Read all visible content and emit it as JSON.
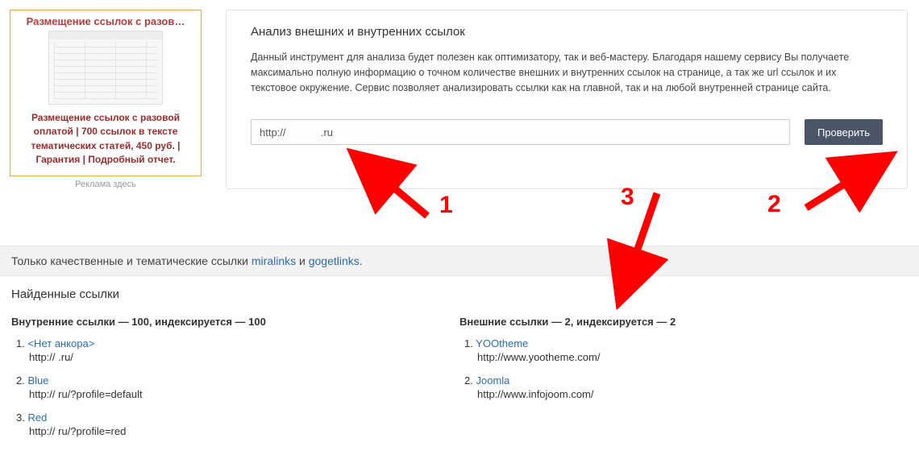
{
  "ad": {
    "title": "Размещение ссылок с разов…",
    "description": "Размещение ссылок с разовой оплатой | 700 ссылок в тексте тематических статей, 450 руб. | Гарантия | Подробный отчет.",
    "below": "Реклама здесь"
  },
  "panel": {
    "heading": "Анализ внешних и внутренних ссылок",
    "text": "Данный инструмент для анализа будет полезен как оптимизатору, так и веб-мастеру. Благодаря нашему сервису Вы получаете максимально полную информацию о точном количестве внешних и внутренних ссылок на странице, а так же url ссылок и их текстовое окружение. Сервис позволяет анализировать ссылки как на главной, так и на любой внутренней странице сайта.",
    "url_value": "http://            .ru",
    "button": "Проверить"
  },
  "banner": {
    "prefix": "Только качественные и тематические ссылки ",
    "link1": "miralinks",
    "joiner": " и ",
    "link2": "gogetlinks",
    "suffix": "."
  },
  "results": {
    "heading": "Найденные ссылки",
    "internal_heading": "Внутренние ссылки — 100, индексируется — 100",
    "external_heading": "Внешние ссылки — 2, индексируется — 2",
    "internal": [
      {
        "n": "1.",
        "anchor": "<Нет анкора>",
        "url": "http://              .ru/"
      },
      {
        "n": "2.",
        "anchor": "Blue",
        "url": "http://               ru/?profile=default"
      },
      {
        "n": "3.",
        "anchor": "Red",
        "url": "http://               ru/?profile=red"
      }
    ],
    "external": [
      {
        "n": "1.",
        "anchor": "YOOtheme",
        "url": "http://www.yootheme.com/"
      },
      {
        "n": "2.",
        "anchor": "Joomla",
        "url": "http://www.infojoom.com/"
      }
    ]
  },
  "annotations": {
    "n1": "1",
    "n2": "2",
    "n3": "3"
  }
}
